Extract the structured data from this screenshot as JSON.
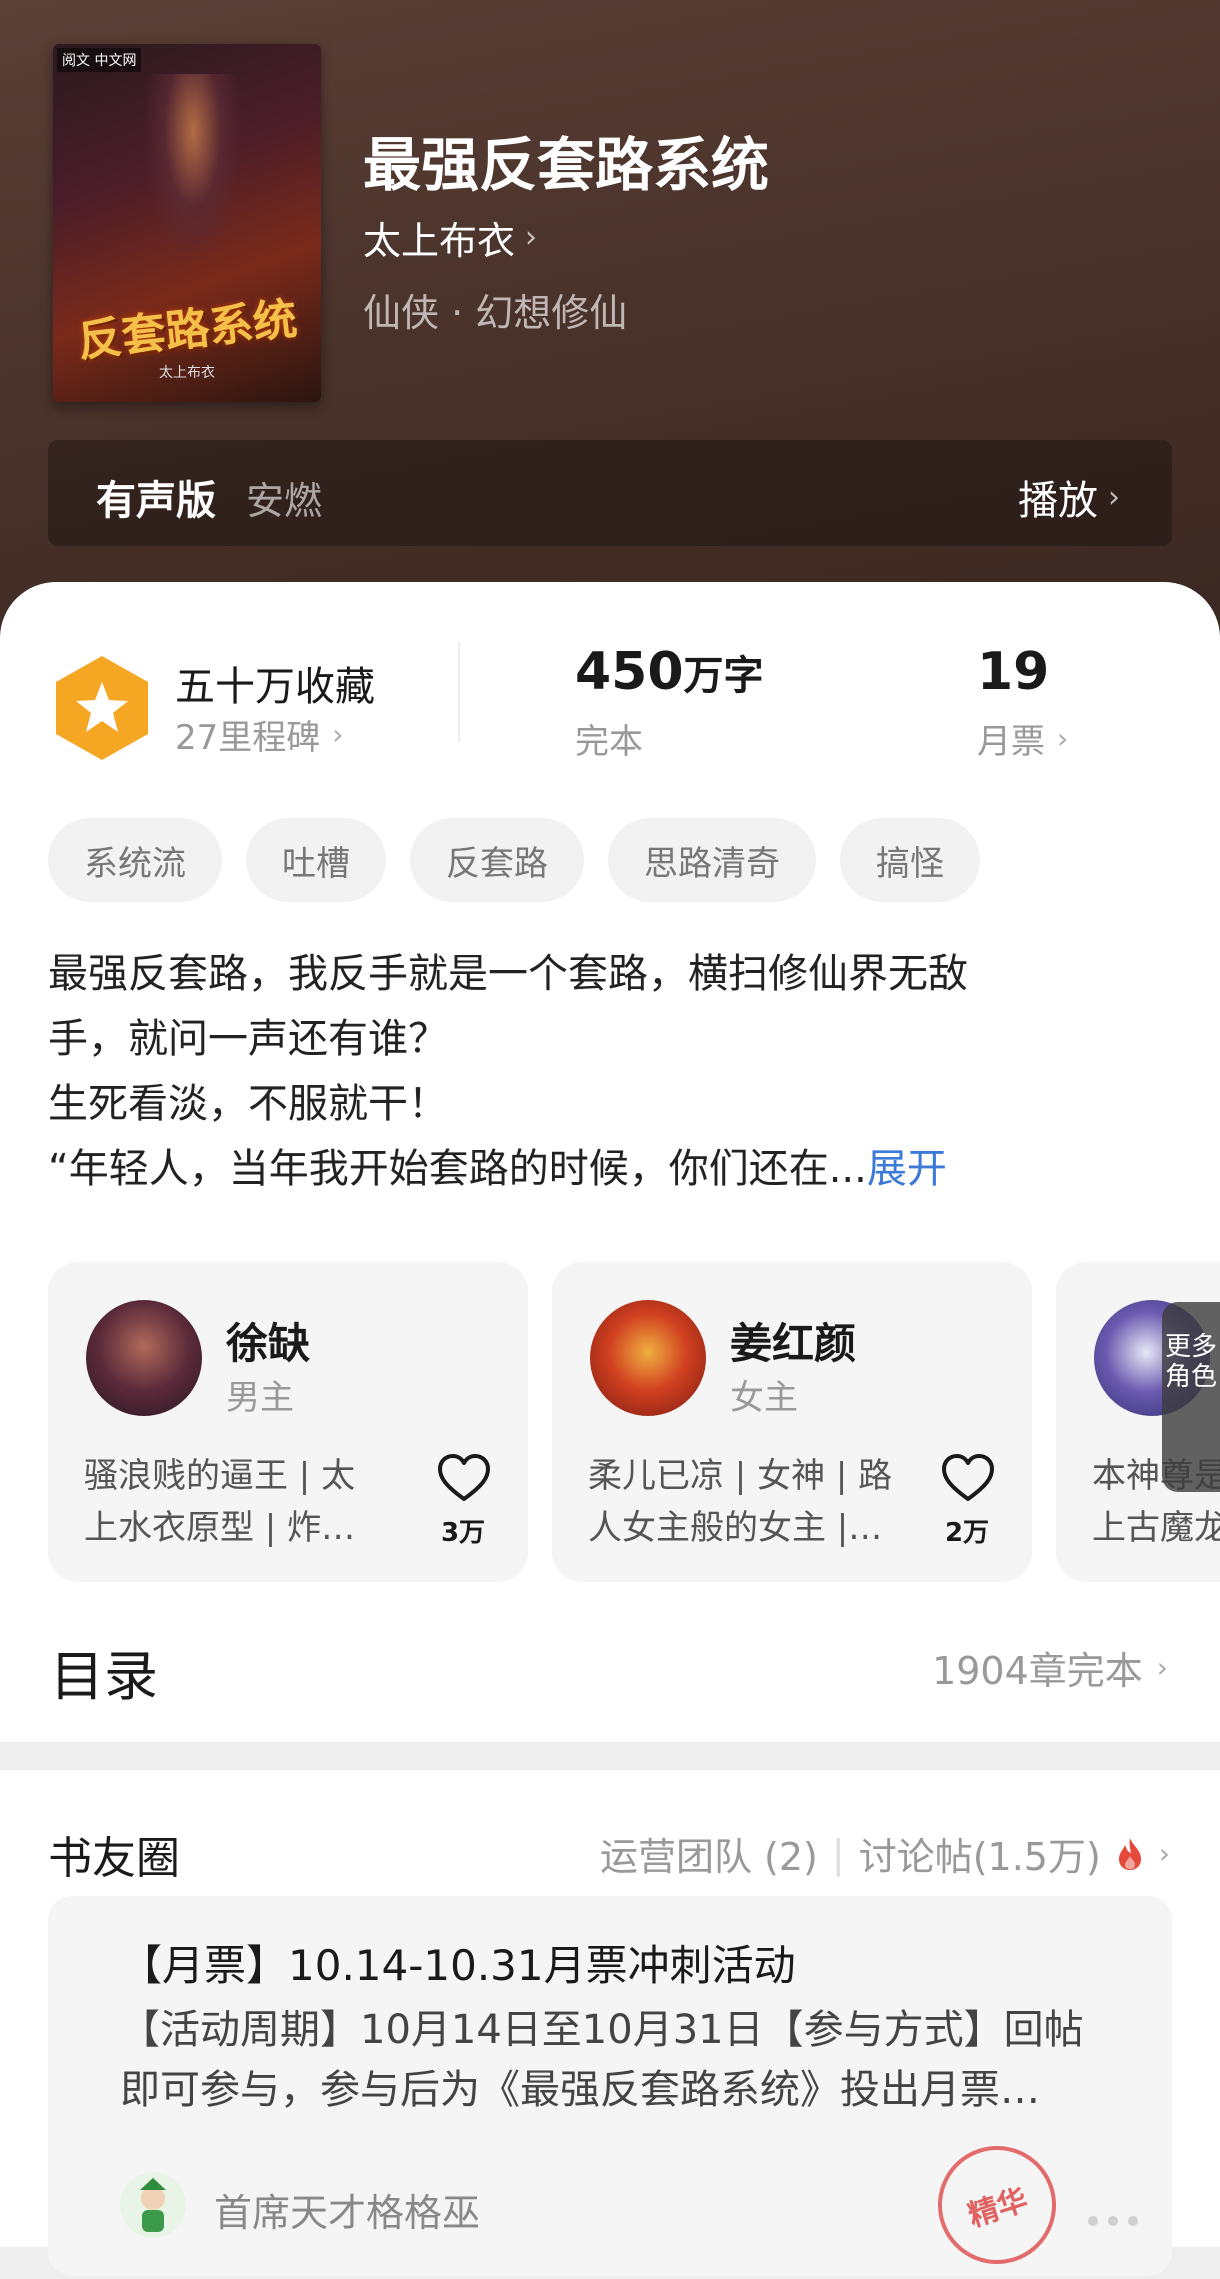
{
  "book": {
    "title": "最强反套路系统",
    "author": "太上布衣",
    "genre": "仙侠 · 幻想修仙",
    "cover": {
      "publisher": "阅文 中文网",
      "title_art": "反套路系统",
      "author_art": "太上布衣"
    }
  },
  "audio": {
    "label": "有声版",
    "narrator": "安燃",
    "play_label": "播放"
  },
  "stats": {
    "collection_title": "五十万收藏",
    "milestones": "27里程碑",
    "word_count_number": "450",
    "word_count_unit": "万字",
    "status": "完本",
    "monthly_votes": "19",
    "monthly_votes_label": "月票"
  },
  "tags": [
    "系统流",
    "吐槽",
    "反套路",
    "思路清奇",
    "搞怪"
  ],
  "description": {
    "line1": "最强反套路，我反手就是一个套路，横扫修仙界无敌",
    "line2": "手，就问一声还有谁？",
    "line3": "生死看淡，不服就干！",
    "line4": "“年轻人，当年我开始套路的时候，你们还在...",
    "expand_label": "展开"
  },
  "characters": [
    {
      "name": "徐缺",
      "role": "男主",
      "desc_line1": "骚浪贱的逼王 | 太",
      "desc_line2": "上水衣原型 | 炸…",
      "likes": "3万"
    },
    {
      "name": "姜红颜",
      "role": "女主",
      "desc_line1": "柔儿已凉 | 女神 | 路",
      "desc_line2": "人女主般的女主 |…",
      "likes": "2万"
    },
    {
      "name": "",
      "role": "",
      "desc_line1": "本神尊是",
      "desc_line2": "上古魔龙",
      "likes": ""
    }
  ],
  "more_roles_label": "更多角色",
  "toc": {
    "title": "目录",
    "summary": "1904章完本"
  },
  "circle": {
    "title": "书友圈",
    "ops_team": "运营团队 (2)",
    "discussions": "讨论帖(1.5万)",
    "post": {
      "title": "【月票】10.14-10.31月票冲刺活动",
      "body_line1": "【活动周期】10月14日至10月31日【参与方式】回帖",
      "body_line2": "即可参与，参与后为《最强反套路系统》投出月票…",
      "author": "首席天才格格巫",
      "stamp": "精华"
    }
  },
  "colors": {
    "header_bg": "#4a332b",
    "badge": "#f5a623",
    "link": "#3b7ad9",
    "hot": "#e5493a"
  }
}
